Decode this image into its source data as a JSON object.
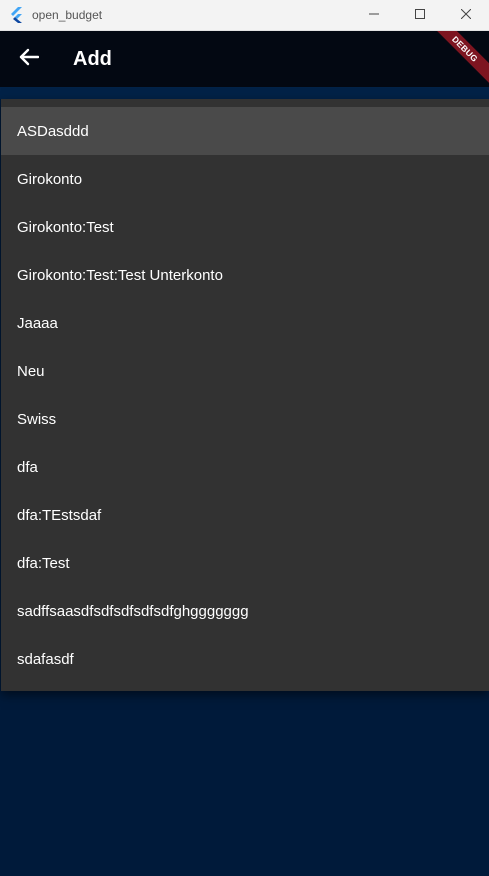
{
  "window": {
    "title": "open_budget",
    "icons": {
      "logo": "flutter-logo-icon",
      "minimize": "minimize-icon",
      "maximize": "maximize-icon",
      "close": "close-icon"
    }
  },
  "appbar": {
    "title": "Add",
    "back_icon": "arrow-left-icon",
    "debug_label": "DEBUG"
  },
  "menu": {
    "selected_index": 0,
    "items": [
      {
        "label": "ASDasddd"
      },
      {
        "label": "Girokonto"
      },
      {
        "label": "Girokonto:Test"
      },
      {
        "label": "Girokonto:Test:Test Unterkonto"
      },
      {
        "label": "Jaaaa"
      },
      {
        "label": "Neu"
      },
      {
        "label": "Swiss"
      },
      {
        "label": "dfa"
      },
      {
        "label": "dfa:TEstsdaf"
      },
      {
        "label": "dfa:Test"
      },
      {
        "label": "sadffsaasdfsdfsdfsdfsdfghggggggg"
      },
      {
        "label": "sdafasdf"
      }
    ]
  },
  "colors": {
    "background": "#001a3a",
    "appbar": "#030812",
    "menu": "#323232",
    "menu_selected": "#4a4a4a",
    "debug_ribbon": "#7d1520"
  }
}
